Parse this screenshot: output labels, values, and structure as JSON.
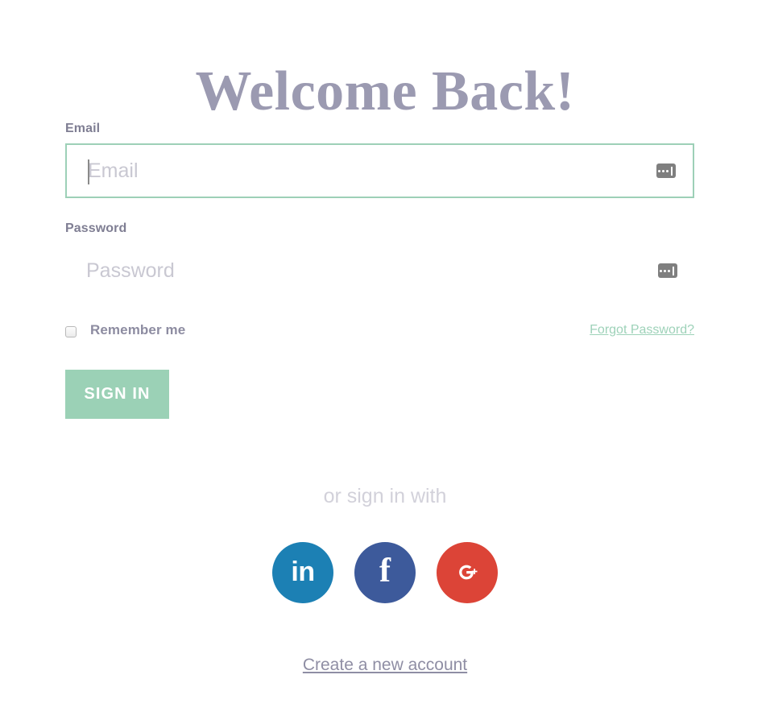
{
  "page": {
    "title": "Welcome Back!",
    "background_color": "#ffffff",
    "title_color": "#9b9ab1"
  },
  "form": {
    "email": {
      "label": "Email",
      "placeholder": "Email",
      "value": "",
      "focused": true,
      "border_color": "#9dd0b7",
      "autofill_icon": "password-autofill-icon"
    },
    "password": {
      "label": "Password",
      "placeholder": "Password",
      "value": "",
      "focused": false,
      "autofill_icon": "password-autofill-icon"
    },
    "remember_me": {
      "label": "Remember me",
      "checked": false
    },
    "forgot_password": {
      "label": "Forgot Password?",
      "color": "#9ed2b9"
    },
    "submit": {
      "label": "SIGN IN",
      "background_color": "#9bd1b6",
      "text_color": "#ffffff"
    }
  },
  "social": {
    "divider_text": "or sign in with",
    "buttons": [
      {
        "name": "linkedin",
        "glyph": "in",
        "color": "#1c80b4"
      },
      {
        "name": "facebook",
        "glyph": "f",
        "color": "#3d5a9b"
      },
      {
        "name": "google-plus",
        "glyph": "G+",
        "color": "#dc4437"
      }
    ]
  },
  "footer": {
    "create_account": "Create a new account"
  }
}
